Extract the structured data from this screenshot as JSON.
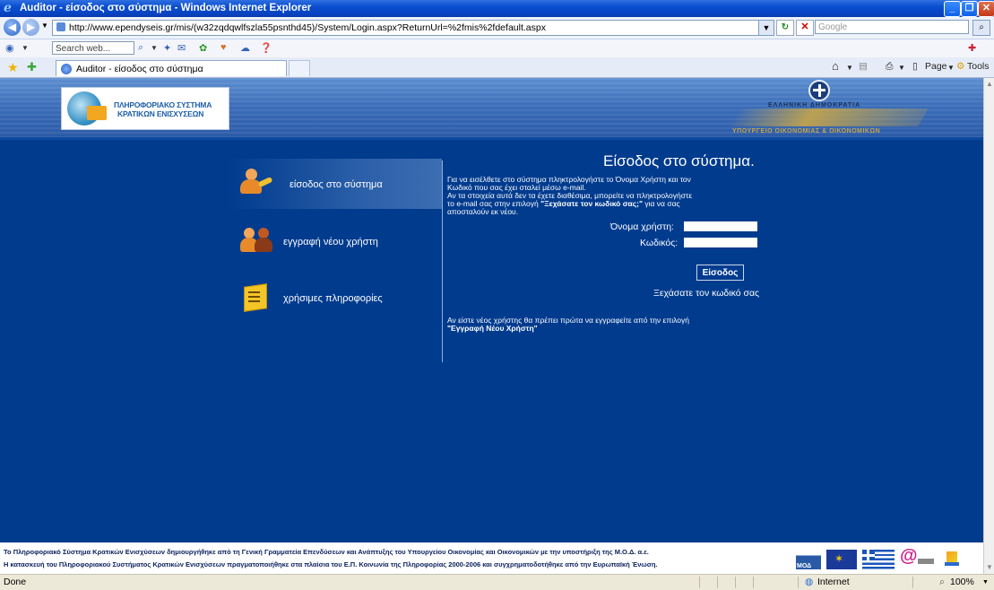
{
  "window": {
    "title": "Auditor - είσοδος στο σύστημα - Windows Internet Explorer",
    "min": "_",
    "max": "❐",
    "close": "✕"
  },
  "address": {
    "url": "http://www.ependyseis.gr/mis/(w32zqdqwlfszla55psnthd45)/System/Login.aspx?ReturnUrl=%2fmis%2fdefault.aspx",
    "search_placeholder": "Google"
  },
  "toolbar": {
    "search_web": "Search web..."
  },
  "tabs": {
    "active_label": "Auditor - είσοδος στο σύστημα",
    "page_label": "Page",
    "tools_label": "Tools"
  },
  "banner": {
    "logo_line1": "ΠΛΗΡΟΦΟΡΙΑΚΟ ΣΥΣΤΗΜΑ",
    "logo_line2": "ΚΡΑΤΙΚΩΝ ΕΝΙΣΧΥΣΕΩΝ",
    "republic": "ΕΛΛΗΝΙΚΗ ΔΗΜΟΚΡΑΤΙΑ",
    "ministry": "ΥΠΟΥΡΓΕΙΟ ΟΙΚΟΝΟΜΙΑΣ & ΟΙΚΟΝΟΜΙΚΩΝ"
  },
  "menu": {
    "items": [
      {
        "label": "είσοδος στο σύστημα"
      },
      {
        "label": "εγγραφή νέου χρήστη"
      },
      {
        "label": "χρήσιμες πληροφορίες"
      }
    ]
  },
  "login": {
    "title": "Είσοδος στο σύστημα.",
    "info_line1": "Για να εισέλθετε στο σύστημα πληκτρολογήστε το Όνομα Χρήστη και τον",
    "info_line2": "Κωδικό που σας έχει σταλεί μέσω e-mail.",
    "info_line3": "Αν τα στοιχεία αυτά δεν τα έχετε διαθέσιμα, μπορείτε να πληκτρολογήστε",
    "info_line4a": "το e-mail σας στην επιλογή ",
    "info_line4b": "\"Ξεχάσατε τον κωδικό σας;\"",
    "info_line4c": " για να σας",
    "info_line5": "αποσταλούν εκ νέου.",
    "username_label": "Όνομα χρήστη:",
    "password_label": "Κωδικός:",
    "username_value": "",
    "password_value": "",
    "submit_label": "Είσοδος",
    "forgot_label": "Ξεχάσατε τον κωδικό σας",
    "newuser_line1": "Αν είστε νέος χρήστης θα πρέπει πρώτα να εγγραφείτε από την επιλογή",
    "newuser_line2": "\"Εγγραφή Νέου Χρήστη\""
  },
  "footer": {
    "line1": "Το Πληροφοριακό Σύστημα Κρατικών Ενισχύσεων δημιουργήθηκε από τη Γενική Γραμματεία Επενδύσεων και Ανάπτυξης του Υπουργείου Οικονομίας και Οικονομικών με την υποστήριξη της Μ.Ο.Δ. α.ε.",
    "line2": "Η κατασκευή του Πληροφοριακού Συστήματος Κρατικών Ενισχύσεων πραγματοποιήθηκε στα πλαίσια του Ε.Π. Κοινωνία της Πληροφορίας 2000-2006 και συγχρηματοδοτήθηκε από την Ευρωπαϊκή Ένωση.",
    "mod_logo": "ΜΟΔ"
  },
  "status": {
    "left": "Done",
    "zone": "Internet",
    "zoom": "100%"
  },
  "colors": {
    "page_bg": "#003b8e",
    "banner": "#3a6cb8",
    "titlebar": "#0a4ed0"
  }
}
